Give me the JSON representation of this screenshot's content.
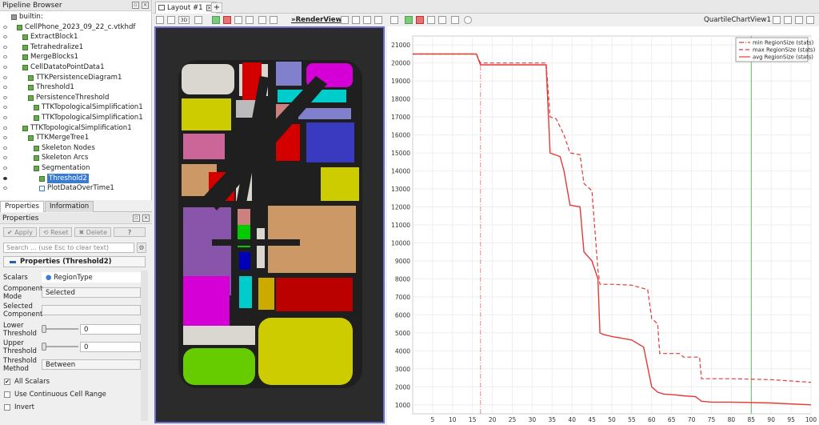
{
  "pipeline": {
    "title": "Pipeline Browser",
    "items": [
      {
        "label": "builtin:",
        "depth": 0,
        "eye": "none",
        "icon": "server"
      },
      {
        "label": "CellPhone_2023_09_22_c.vtkhdf",
        "depth": 1,
        "eye": "off",
        "icon": "cube"
      },
      {
        "label": "ExtractBlock1",
        "depth": 2,
        "eye": "off",
        "icon": "cube"
      },
      {
        "label": "Tetrahedralize1",
        "depth": 2,
        "eye": "off",
        "icon": "cube"
      },
      {
        "label": "MergeBlocks1",
        "depth": 2,
        "eye": "off",
        "icon": "cube"
      },
      {
        "label": "CellDatatoPointData1",
        "depth": 2,
        "eye": "off",
        "icon": "cube"
      },
      {
        "label": "TTKPersistenceDiagram1",
        "depth": 3,
        "eye": "off",
        "icon": "cube"
      },
      {
        "label": "Threshold1",
        "depth": 3,
        "eye": "off",
        "icon": "cube"
      },
      {
        "label": "PersistenceThreshold",
        "depth": 3,
        "eye": "off",
        "icon": "cube"
      },
      {
        "label": "TTKTopologicalSimplification1",
        "depth": 4,
        "eye": "off",
        "icon": "cube"
      },
      {
        "label": "TTKTopologicalSimplification1",
        "depth": 4,
        "eye": "off",
        "icon": "cube"
      },
      {
        "label": "TTKTopologicalSimplification1",
        "depth": 2,
        "eye": "off",
        "icon": "cube"
      },
      {
        "label": "TTKMergeTree1",
        "depth": 3,
        "eye": "off",
        "icon": "cube"
      },
      {
        "label": "Skeleton Nodes",
        "depth": 4,
        "eye": "off",
        "icon": "cube"
      },
      {
        "label": "Skeleton Arcs",
        "depth": 4,
        "eye": "off",
        "icon": "cube"
      },
      {
        "label": "Segmentation",
        "depth": 4,
        "eye": "off",
        "icon": "cube"
      },
      {
        "label": "Threshold2",
        "depth": 5,
        "eye": "on",
        "icon": "cube",
        "selected": true
      },
      {
        "label": "PlotDataOverTime1",
        "depth": 5,
        "eye": "off",
        "icon": "chart"
      }
    ]
  },
  "tabs": {
    "properties": "Properties",
    "information": "Information"
  },
  "properties": {
    "title": "Properties",
    "apply": "Apply",
    "reset": "Reset",
    "delete": "Delete",
    "help": "?",
    "search_placeholder": "Search ... (use Esc to clear text)",
    "section": "Properties (Threshold2)",
    "scalars_label": "Scalars",
    "scalars_value": "RegionType",
    "component_mode_label": "Component Mode",
    "component_mode_value": "Selected",
    "selected_component_label": "Selected Component",
    "lower_label": "Lower Threshold",
    "lower_value": "0",
    "upper_label": "Upper Threshold",
    "upper_value": "0",
    "method_label": "Threshold Method",
    "method_value": "Between",
    "all_scalars": "All Scalars",
    "continuous": "Use Continuous Cell Range",
    "invert": "Invert"
  },
  "layout": {
    "tab": "Layout #1",
    "add": "+"
  },
  "views": {
    "render": "RenderView1",
    "chart": "QuartileChartView1",
    "threed": "3D"
  },
  "colors": {
    "accent": "#3a7bd5",
    "selection_border": "#6b6bd6",
    "series": "#e53935",
    "vline": "#66bb6a"
  },
  "chart_data": {
    "type": "line",
    "xlim": [
      0,
      100
    ],
    "ylim": [
      500,
      21500
    ],
    "xticks": [
      5,
      10,
      15,
      20,
      25,
      30,
      35,
      40,
      45,
      50,
      55,
      60,
      65,
      70,
      75,
      80,
      85,
      90,
      95,
      100
    ],
    "yticks": [
      1000,
      2000,
      3000,
      4000,
      5000,
      6000,
      7000,
      8000,
      9000,
      10000,
      11000,
      12000,
      13000,
      14000,
      15000,
      16000,
      17000,
      18000,
      19000,
      20000,
      21000
    ],
    "legend_position": "top-right",
    "vertical_line_x": 85,
    "series": [
      {
        "name": "min RegionSize (stats)",
        "style": "dashdot",
        "x": [
          17,
          17
        ],
        "y": [
          500,
          20000
        ]
      },
      {
        "name": "max RegionSize (stats)",
        "style": "dashed",
        "x": [
          0,
          16,
          17,
          33.5,
          34.5,
          36,
          38,
          39.5,
          42,
          43,
          45,
          46.5,
          47,
          50,
          55,
          59,
          60,
          61.5,
          62,
          67,
          68,
          72,
          72.5,
          80,
          90,
          100
        ],
        "y": [
          20500,
          20500,
          20000,
          20000,
          17000,
          16900,
          16000,
          15000,
          14900,
          13300,
          12900,
          8500,
          7700,
          7700,
          7650,
          7400,
          5800,
          5500,
          3850,
          3850,
          3650,
          3650,
          2450,
          2450,
          2400,
          2250
        ]
      },
      {
        "name": "avg RegionSize (stats)",
        "style": "solid",
        "x": [
          0,
          16,
          17,
          33.5,
          34.5,
          37,
          38,
          39.5,
          42,
          43,
          45,
          46.5,
          47,
          48,
          50,
          55,
          58,
          60,
          61.5,
          63,
          66,
          68,
          71,
          72.5,
          75,
          80,
          90,
          100
        ],
        "y": [
          20500,
          20500,
          19900,
          19900,
          15000,
          14800,
          14000,
          12100,
          12000,
          9500,
          9000,
          8000,
          5000,
          4900,
          4800,
          4600,
          4200,
          2000,
          1700,
          1600,
          1550,
          1500,
          1450,
          1200,
          1150,
          1150,
          1100,
          1000
        ]
      }
    ]
  }
}
